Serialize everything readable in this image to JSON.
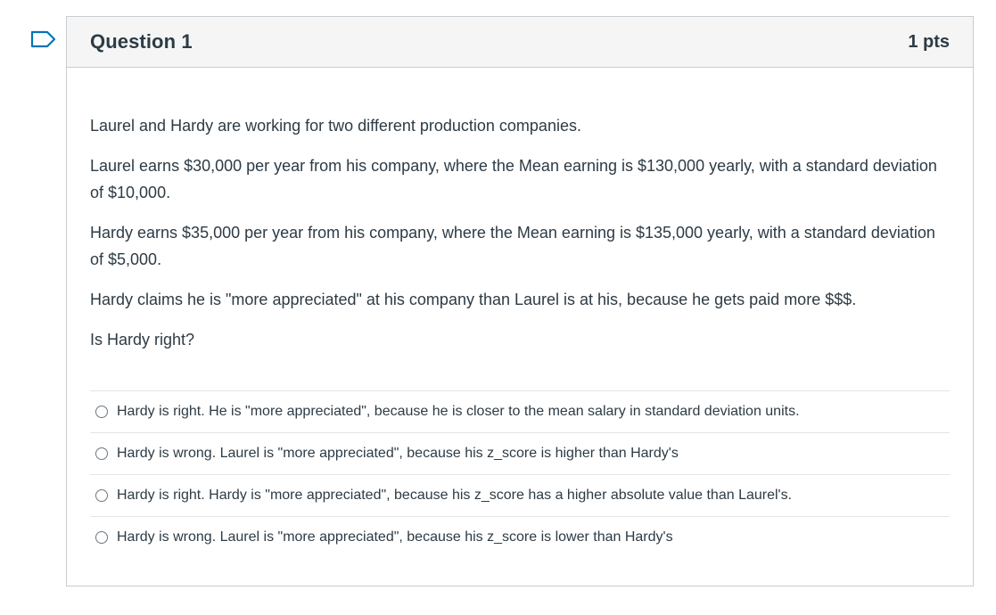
{
  "question": {
    "title": "Question 1",
    "points": "1 pts",
    "flag_icon": "bookmark-flag-icon",
    "accent_color": "#0374b5",
    "paragraphs": [
      "Laurel and Hardy are working for two different production companies.",
      "Laurel earns $30,000 per year from his company, where the Mean earning is $130,000 yearly, with a standard deviation of $10,000.",
      "Hardy earns $35,000 per year from his company, where the Mean earning is $135,000 yearly, with a standard deviation of $5,000.",
      "Hardy claims he is \"more appreciated\" at his company than Laurel is at his, because he gets paid more $$$.",
      "Is Hardy right?"
    ],
    "answers": [
      "Hardy is right. He is \"more appreciated\", because he is closer to the mean salary in standard deviation units.",
      "Hardy is wrong. Laurel is \"more appreciated\", because his z_score is higher than Hardy's",
      "Hardy is right. Hardy is \"more appreciated\", because his z_score has a higher absolute value than Laurel's.",
      "Hardy is wrong. Laurel is \"more appreciated\", because his z_score is lower than Hardy's"
    ]
  }
}
